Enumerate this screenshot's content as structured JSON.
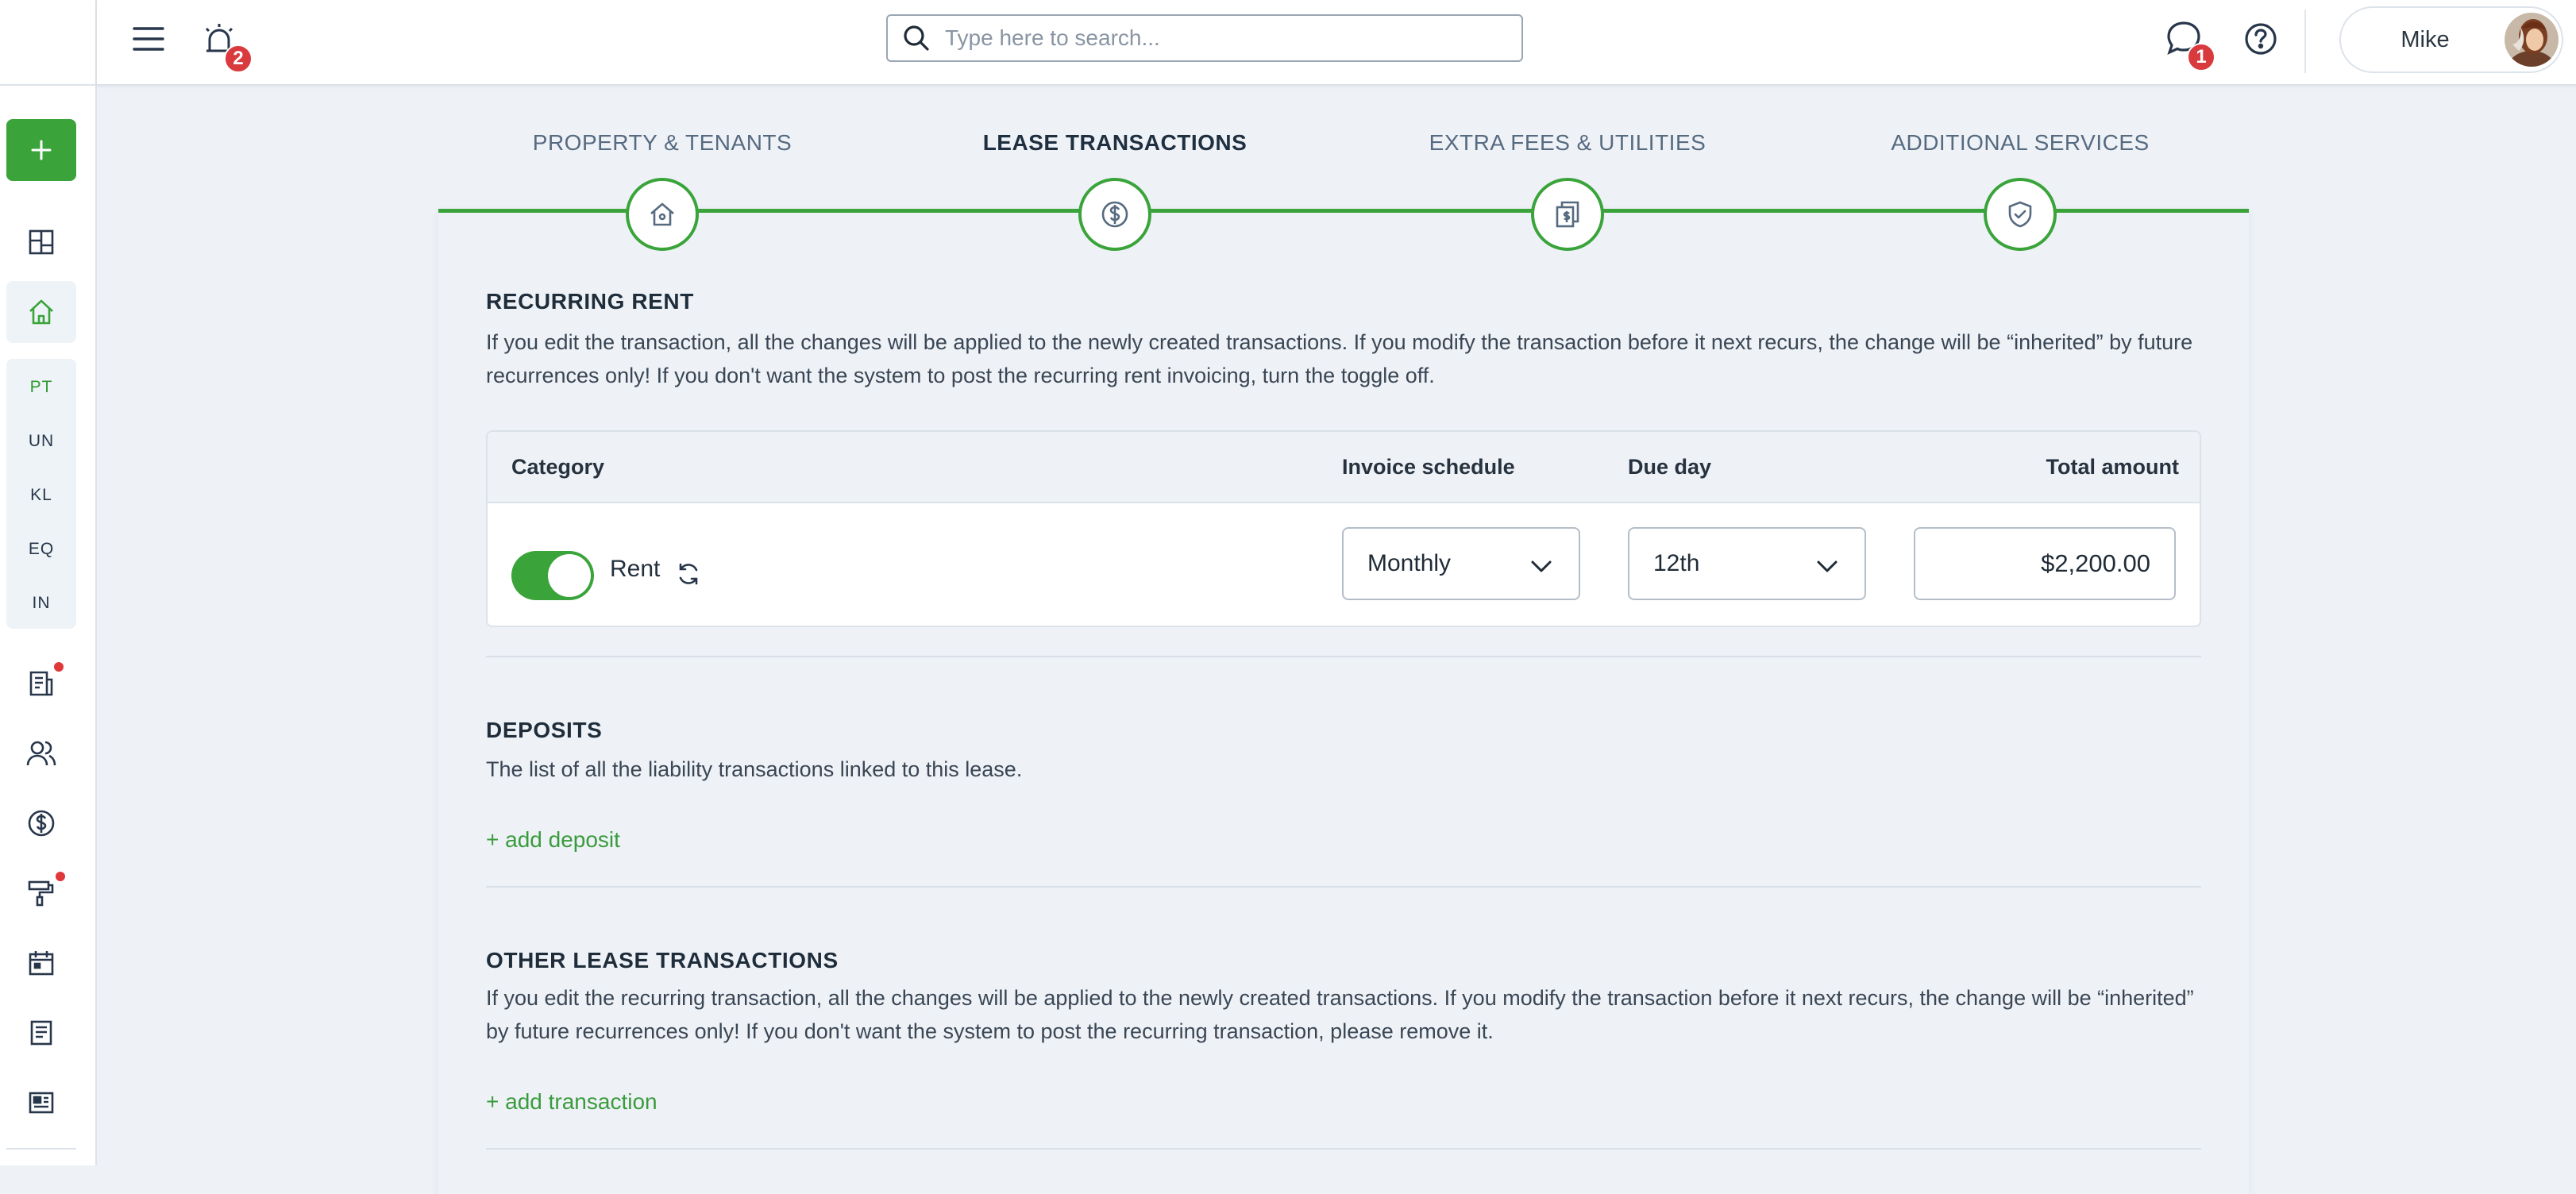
{
  "header": {
    "notifications_count": "2",
    "search_placeholder": "Type here to search...",
    "messages_count": "1",
    "user_name": "Mike"
  },
  "sidebar": {
    "icons": [
      "plus-icon",
      "dashboard-icon",
      "home-icon",
      "invoice-icon",
      "users-icon",
      "dollar-icon",
      "paint-roller-icon",
      "calendar-icon",
      "document-icon",
      "news-icon"
    ],
    "sub_items": [
      "PT",
      "UN",
      "KL",
      "EQ",
      "IN"
    ]
  },
  "stepper": {
    "steps": [
      {
        "label": "PROPERTY & TENANTS",
        "icon": "house-icon"
      },
      {
        "label": "LEASE TRANSACTIONS",
        "icon": "dollar-icon"
      },
      {
        "label": "EXTRA FEES & UTILITIES",
        "icon": "documents-dollar-icon"
      },
      {
        "label": "ADDITIONAL SERVICES",
        "icon": "shield-check-icon"
      }
    ],
    "active_index": 1
  },
  "recurring_rent": {
    "title": "RECURRING RENT",
    "description": "If you edit the transaction, all the changes will be applied to the newly created transactions. If you modify the transaction before it next recurs, the change will be “inherited” by future recurrences only! If you don't want the system to post the recurring rent invoicing, turn the toggle off.",
    "columns": {
      "category": "Category",
      "invoice_schedule": "Invoice schedule",
      "due_day": "Due day",
      "total_amount": "Total amount"
    },
    "row": {
      "enabled": true,
      "category": "Rent",
      "invoice_schedule": "Monthly",
      "due_day": "12th",
      "total_amount": "$2,200.00"
    }
  },
  "deposits": {
    "title": "DEPOSITS",
    "description": "The list of all the liability transactions linked to this lease.",
    "add_link": "+ add deposit"
  },
  "other_transactions": {
    "title": "OTHER LEASE TRANSACTIONS",
    "description": "If you edit the recurring transaction, all the changes will be applied to the newly created transactions. If you modify the transaction before it next recurs, the change will be “inherited” by future recurrences only! If you don't want the system to post the recurring transaction, please remove it.",
    "add_link": "+ add transaction"
  },
  "colors": {
    "accent_green": "#3aa43b",
    "badge_red": "#d93a3d",
    "background": "#eef2f7"
  }
}
